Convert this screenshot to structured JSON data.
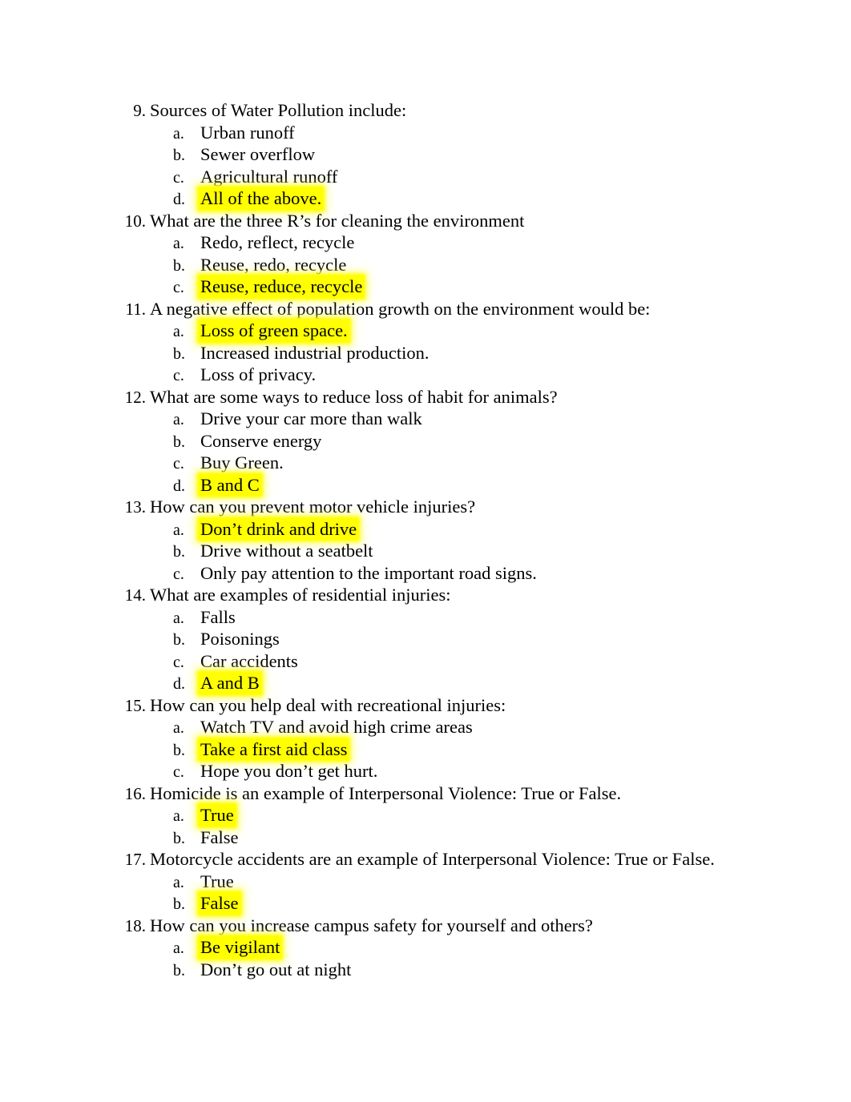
{
  "document": {
    "type": "quiz-worksheet",
    "highlight_color": "#ffff00",
    "text_color": "#000000",
    "background_color": "#ffffff"
  },
  "questions": [
    {
      "number": "9.",
      "text": "Sources of Water Pollution include:",
      "answers": [
        {
          "letter": "a.",
          "text": "Urban runoff",
          "highlighted": false
        },
        {
          "letter": "b.",
          "text": "Sewer overflow",
          "highlighted": false
        },
        {
          "letter": "c.",
          "text": "Agricultural runoff",
          "highlighted": false
        },
        {
          "letter": "d.",
          "text": "All of the above.",
          "highlighted": true
        }
      ]
    },
    {
      "number": "10.",
      "text": "What are the three R’s for cleaning the environment",
      "answers": [
        {
          "letter": "a.",
          "text": "Redo, reflect, recycle",
          "highlighted": false
        },
        {
          "letter": "b.",
          "text": "Reuse, redo, recycle",
          "highlighted": false
        },
        {
          "letter": "c.",
          "text": "Reuse, reduce, recycle",
          "highlighted": true
        }
      ]
    },
    {
      "number": "11.",
      "text": "A negative effect of population growth on the environment would be:",
      "answers": [
        {
          "letter": "a.",
          "text": "Loss of green space.",
          "highlighted": true
        },
        {
          "letter": "b.",
          "text": "Increased industrial production.",
          "highlighted": false
        },
        {
          "letter": "c.",
          "text": "Loss of privacy.",
          "highlighted": false
        }
      ]
    },
    {
      "number": "12.",
      "text": "What are some ways to reduce loss of habit for animals?",
      "answers": [
        {
          "letter": "a.",
          "text": "Drive your car more than walk",
          "highlighted": false
        },
        {
          "letter": "b.",
          "text": "Conserve energy",
          "highlighted": false
        },
        {
          "letter": "c.",
          "text": "Buy Green.",
          "highlighted": false
        },
        {
          "letter": "d.",
          "text": "B and C",
          "highlighted": true
        }
      ]
    },
    {
      "number": "13.",
      "text": "How can you prevent motor vehicle injuries?",
      "answers": [
        {
          "letter": "a.",
          "text": "Don’t drink and drive",
          "highlighted": true
        },
        {
          "letter": "b.",
          "text": "Drive without a seatbelt",
          "highlighted": false
        },
        {
          "letter": "c.",
          "text": "Only pay attention to the important road signs.",
          "highlighted": false
        }
      ]
    },
    {
      "number": "14.",
      "text": "What are examples of residential injuries:",
      "answers": [
        {
          "letter": "a.",
          "text": "Falls",
          "highlighted": false
        },
        {
          "letter": "b.",
          "text": "Poisonings",
          "highlighted": false
        },
        {
          "letter": "c.",
          "text": "Car accidents",
          "highlighted": false
        },
        {
          "letter": "d.",
          "text": "A and B",
          "highlighted": true
        }
      ]
    },
    {
      "number": "15.",
      "text": "How can you help deal with recreational injuries:",
      "answers": [
        {
          "letter": "a.",
          "text": "Watch TV and avoid high crime areas",
          "highlighted": false
        },
        {
          "letter": "b.",
          "text": "Take a first aid class",
          "highlighted": true
        },
        {
          "letter": "c.",
          "text": "Hope you don’t get hurt.",
          "highlighted": false
        }
      ]
    },
    {
      "number": "16.",
      "text": "Homicide is an example of Interpersonal Violence: True or False.",
      "answers": [
        {
          "letter": "a.",
          "text": "True",
          "highlighted": true
        },
        {
          "letter": "b.",
          "text": "False",
          "highlighted": false
        }
      ]
    },
    {
      "number": "17.",
      "text": "Motorcycle accidents are an example of Interpersonal Violence: True or False.",
      "answers": [
        {
          "letter": "a.",
          "text": "True",
          "highlighted": false
        },
        {
          "letter": "b.",
          "text": "False",
          "highlighted": true
        }
      ]
    },
    {
      "number": "18.",
      "text": "How can you increase campus safety for yourself and others?",
      "answers": [
        {
          "letter": "a.",
          "text": "Be vigilant",
          "highlighted": true
        },
        {
          "letter": "b.",
          "text": "Don’t go out at night",
          "highlighted": false
        }
      ]
    }
  ]
}
